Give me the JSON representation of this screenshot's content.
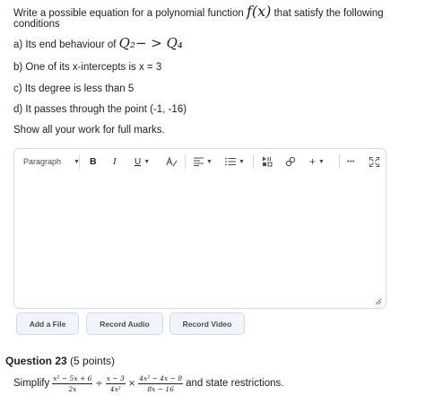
{
  "question": {
    "intro_before": "Write a possible equation for a polynomial function ",
    "intro_math": "f(x)",
    "intro_after": " that satisfy the following",
    "intro_line2": "conditions",
    "cond_a_prefix": "a) Its end behaviour of ",
    "cond_a_math": "Q₂− > Q₄",
    "cond_b": "b) One of its x-intercepts is x = 3",
    "cond_c": "c)  Its degree is less than 5",
    "cond_d": "d) It passes through the point (-1, -16)",
    "instruction": "Show all your work for full marks."
  },
  "editor": {
    "paragraph_label": "Paragraph",
    "bold_icon": "B",
    "italic_icon": "I",
    "underline_icon": "U",
    "plus_icon": "+",
    "more_icon": "•••"
  },
  "buttons": {
    "add_file": "Add a File",
    "record_audio": "Record Audio",
    "record_video": "Record Video"
  },
  "question23": {
    "title": "Question 23",
    "points": " (5 points)",
    "simplify": "Simplify",
    "frac1_num": "x² − 5x + 6",
    "frac1_den": "2x",
    "div": "÷",
    "frac2_num": "x − 3",
    "frac2_den": "4x²",
    "times": "×",
    "frac3_num": "4x² − 4x − 8",
    "frac3_den": "8x − 16",
    "tail": "and state restrictions."
  }
}
